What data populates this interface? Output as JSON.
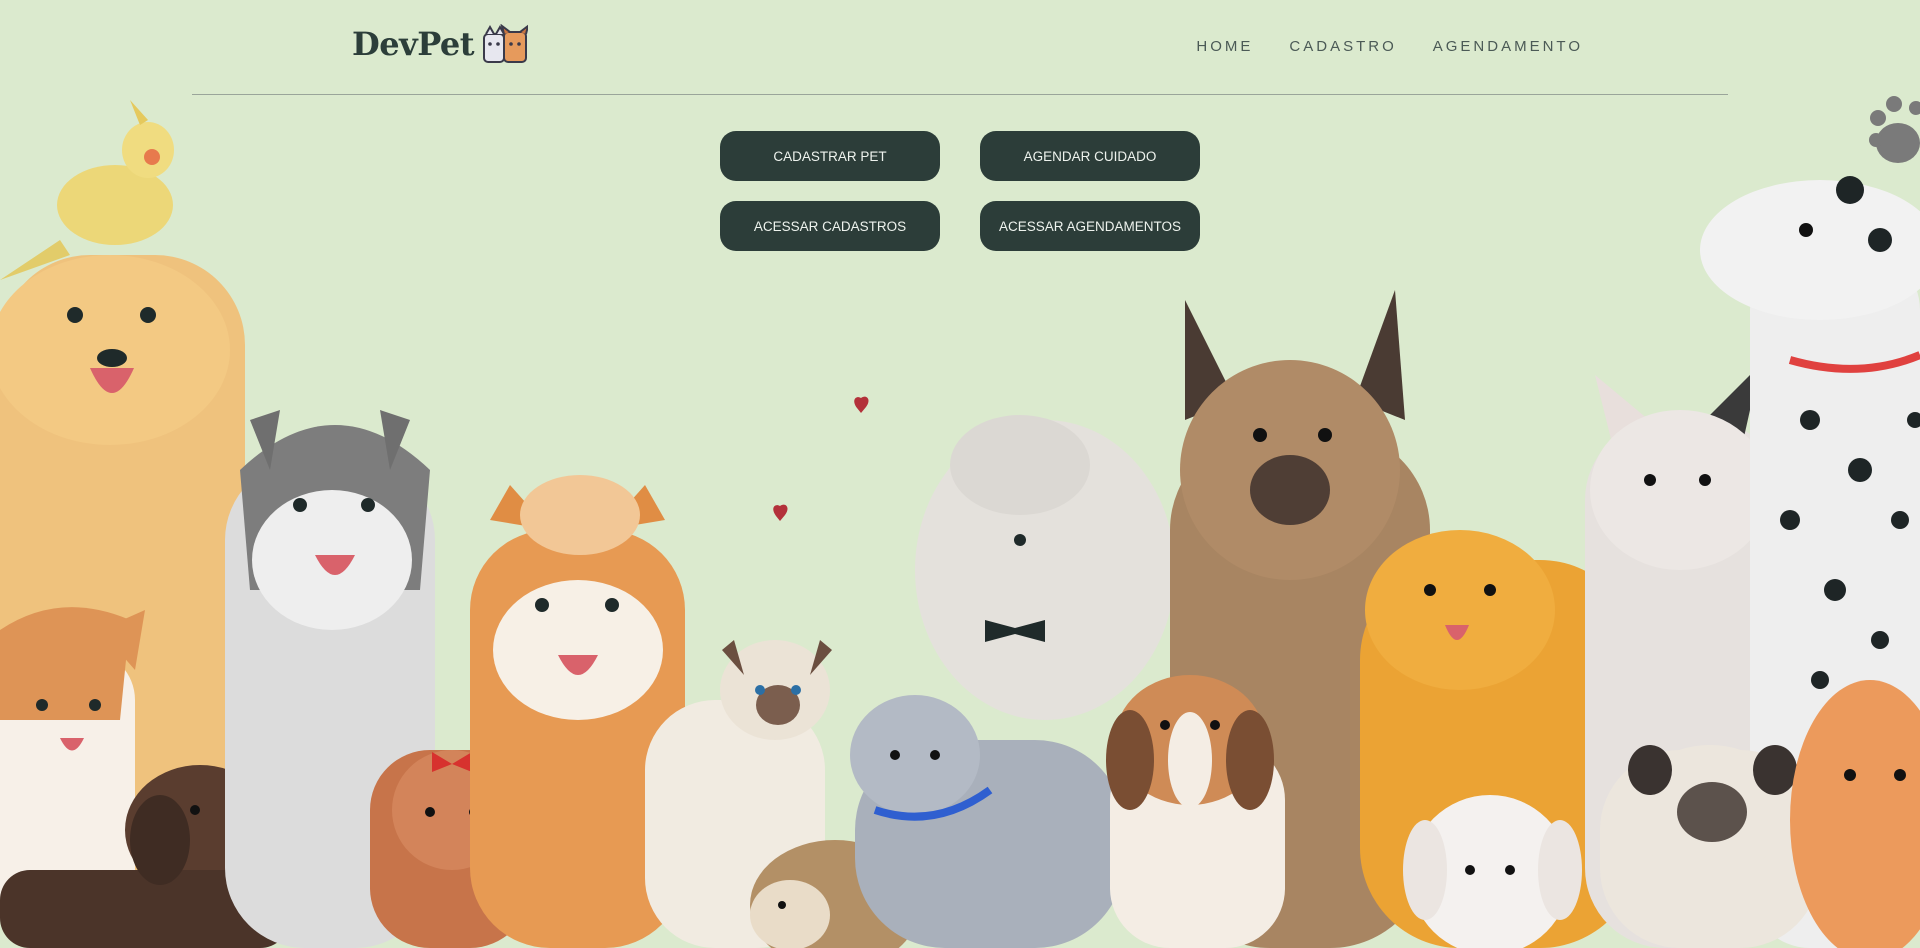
{
  "header": {
    "logo_text": "DevPet",
    "logo_icon": "cat-and-dog-icon",
    "nav": [
      {
        "label": "HOME"
      },
      {
        "label": "CADASTRO"
      },
      {
        "label": "AGENDAMENTO"
      }
    ]
  },
  "actions": {
    "register_pet": "CADASTRAR PET",
    "schedule_care": "AGENDAR CUIDADO",
    "access_registrations": "ACESSAR CADASTROS",
    "access_schedules": "ACESSAR AGENDAMENTOS"
  },
  "illustration": {
    "description_icon": "pets-group-illustration"
  },
  "colors": {
    "background": "#dbeace",
    "button": "#2c3d39",
    "button_text": "#eef3ee",
    "heading": "#2c3e3a"
  }
}
